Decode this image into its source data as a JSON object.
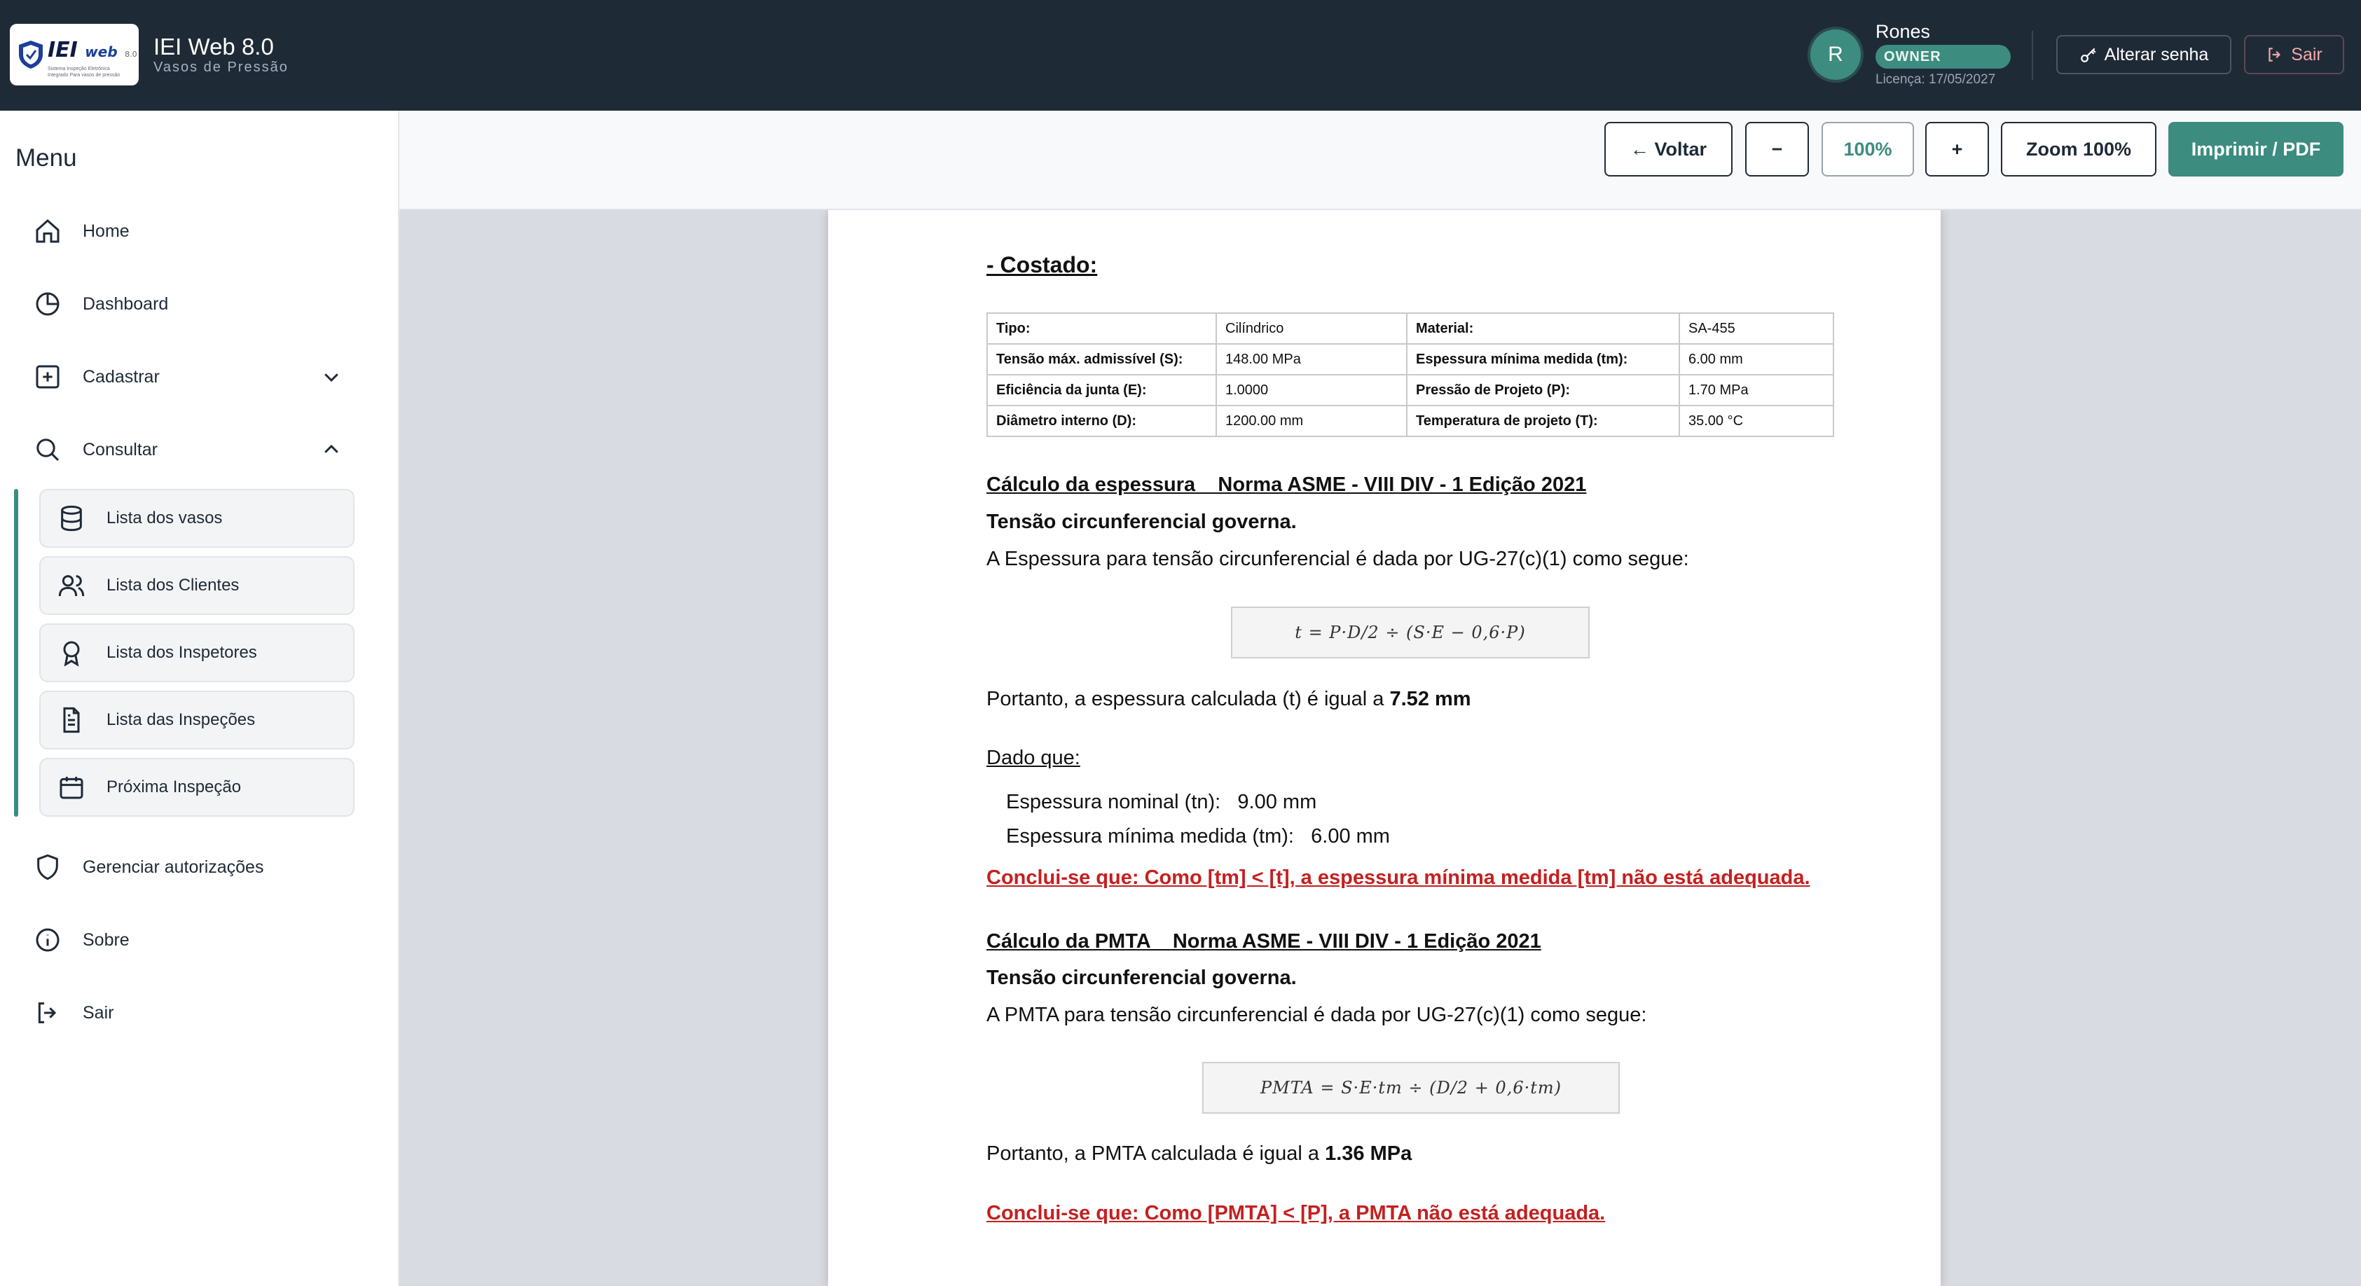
{
  "header": {
    "logo": {
      "brand": "IEI",
      "web": "web",
      "version": "8.0",
      "tagline": "Sistema Inspeção Eletrônica Integrado Para vasos de pressão"
    },
    "app_title": "IEI Web 8.0",
    "app_subtitle": "Vasos de Pressão",
    "user": {
      "initial": "R",
      "name": "Rones",
      "role": "OWNER",
      "license": "Licença: 17/05/2027"
    },
    "change_password_label": "Alterar senha",
    "exit_label": "Sair"
  },
  "sidebar": {
    "title": "Menu",
    "items": [
      {
        "label": "Home",
        "icon": "home-icon"
      },
      {
        "label": "Dashboard",
        "icon": "pie-chart-icon"
      },
      {
        "label": "Cadastrar",
        "icon": "plus-square-icon"
      },
      {
        "label": "Consultar",
        "icon": "search-icon"
      }
    ],
    "consultar_sub": [
      {
        "label": "Lista dos vasos",
        "icon": "database-icon"
      },
      {
        "label": "Lista dos Clientes",
        "icon": "users-icon"
      },
      {
        "label": "Lista dos Inspetores",
        "icon": "award-icon"
      },
      {
        "label": "Lista das Inspeções",
        "icon": "file-text-icon"
      },
      {
        "label": "Próxima Inspeção",
        "icon": "calendar-icon"
      }
    ],
    "bottom_items": [
      {
        "label": "Gerenciar autorizações",
        "icon": "shield-icon"
      },
      {
        "label": "Sobre",
        "icon": "info-icon"
      },
      {
        "label": "Sair",
        "icon": "logout-icon"
      }
    ]
  },
  "toolbar": {
    "back_label": "← Voltar",
    "minus_label": "−",
    "zoom_value": "100%",
    "plus_label": "+",
    "zoom_reset_label": "Zoom 100%",
    "print_label": "Imprimir / PDF"
  },
  "document": {
    "section_title": "- Costado:",
    "spec_table": [
      {
        "l1": "Tipo:",
        "v1": "Cilíndrico",
        "l2": "Material:",
        "v2": "SA-455"
      },
      {
        "l1": "Tensão máx. admissível (S):",
        "v1": "148.00 MPa",
        "l2": "Espessura mínima medida (tm):",
        "v2": "6.00 mm"
      },
      {
        "l1": "Eficiência da junta (E):",
        "v1": "1.0000",
        "l2": "Pressão de Projeto (P):",
        "v2": "1.70 MPa"
      },
      {
        "l1": "Diâmetro interno (D):",
        "v1": "1200.00 mm",
        "l2": "Temperatura de projeto (T):",
        "v2": "35.00 °C"
      }
    ],
    "thickness": {
      "title": "Cálculo da espessura    Norma ASME - VIII DIV - 1 Edição 2021",
      "governs": "Tensão circunferencial governa.",
      "intro": "A Espessura para tensão circunferencial é dada por UG-27(c)(1) como segue:",
      "formula": "t = P·D/2 ÷ (S·E − 0,6·P)",
      "result_prefix": "Portanto, a espessura calculada (t) é igual a ",
      "result_value": "7.52 mm",
      "given_label": "Dado que:",
      "nominal_label": "Espessura nominal (tn):",
      "nominal_value": "9.00 mm",
      "min_label": "Espessura mínima medida (tm):",
      "min_value": "6.00 mm",
      "conclusion": "Conclui-se que: Como [tm] < [t], a espessura mínima medida [tm] não está adequada."
    },
    "pmta": {
      "title": "Cálculo da PMTA    Norma ASME - VIII DIV - 1 Edição 2021",
      "governs": "Tensão circunferencial governa.",
      "intro": "A PMTA para tensão circunferencial é dada por UG-27(c)(1) como segue:",
      "formula": "PMTA = S·E·tm ÷ (D/2 + 0,6·tm)",
      "result_prefix": "Portanto, a PMTA calculada é igual a ",
      "result_value": "1.36 MPa",
      "conclusion": "Conclui-se que: Como [PMTA] < [P], a PMTA não está adequada."
    }
  },
  "colors": {
    "header_bg": "#1f2a37",
    "accent": "#3c8c7f",
    "danger": "#c42020"
  }
}
